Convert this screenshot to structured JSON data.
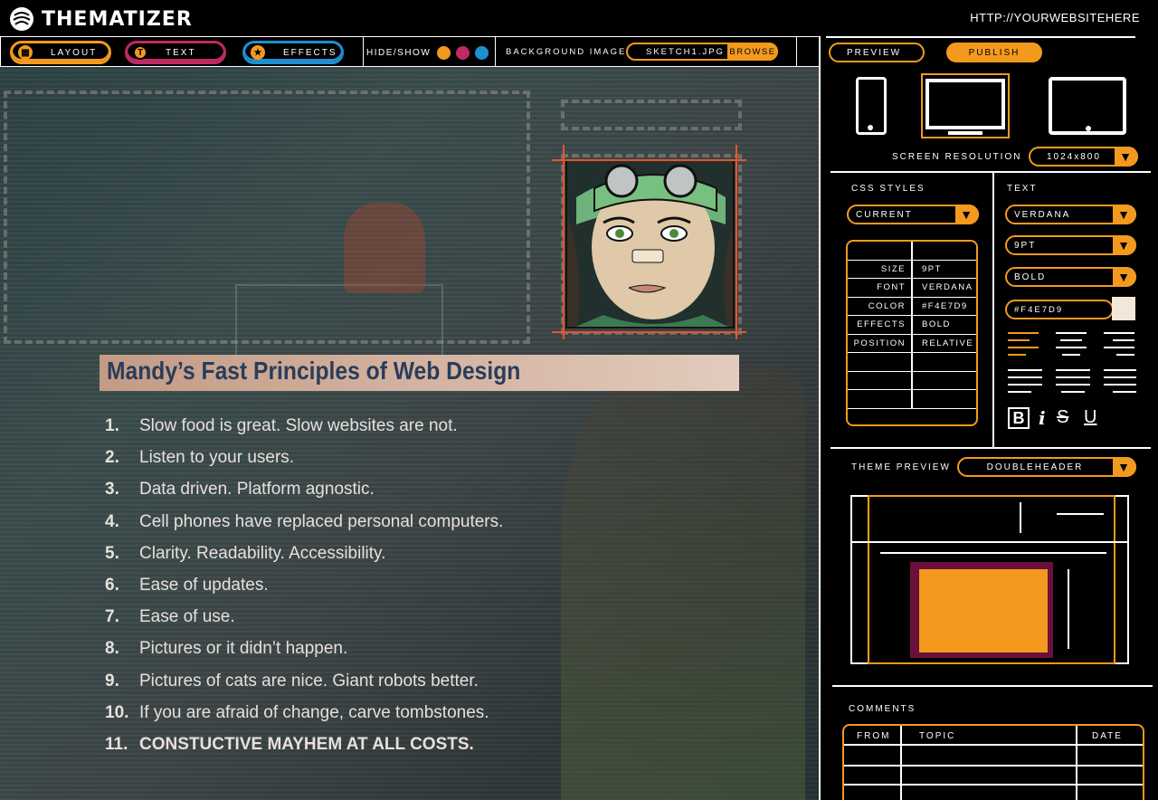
{
  "header": {
    "brand": "THEMATIZER",
    "url": "HTTP://YOURWEBSITEHERE"
  },
  "toolbar": {
    "tabs": [
      {
        "label": "LAYOUT",
        "color": "#f39a1e",
        "icon": "layout-icon"
      },
      {
        "label": "TEXT",
        "color": "#c02a62",
        "icon": "text-icon"
      },
      {
        "label": "EFFECTS",
        "color": "#1f8fcf",
        "icon": "star-icon"
      }
    ],
    "hide_show_label": "HIDE/SHOW",
    "background_image_label": "BACKGROUND IMAGE",
    "background_file": "SKETCH1.JPG",
    "browse_label": "BROWSE"
  },
  "canvas": {
    "heading": "Mandy’s Fast Principles of Web Design",
    "principles": [
      {
        "n": "1.",
        "text": "Slow food is great. Slow websites are not."
      },
      {
        "n": "2.",
        "text": "Listen to your users."
      },
      {
        "n": "3.",
        "text": "Data driven. Platform agnostic."
      },
      {
        "n": "4.",
        "text": "Cell phones have replaced personal computers."
      },
      {
        "n": "5.",
        "text": "Clarity. Readability. Accessibility."
      },
      {
        "n": "6.",
        "text": "Ease of updates."
      },
      {
        "n": "7.",
        "text": "Ease of use."
      },
      {
        "n": "8.",
        "text": "Pictures or it didn’t happen."
      },
      {
        "n": "9.",
        "text": "Pictures of cats are nice. Giant robots better."
      },
      {
        "n": "10.",
        "text": "If you are afraid of change, carve tombstones."
      },
      {
        "n": "11.",
        "text": "CONSTUCTIVE MAYHEM AT ALL COSTS."
      }
    ]
  },
  "panel": {
    "preview_label": "PREVIEW",
    "publish_label": "PUBLISH",
    "screen_resolution_label": "SCREEN RESOLUTION",
    "screen_resolution_value": "1024x800",
    "css_styles_label": "CSS STYLES",
    "css_styles_value": "CURRENT",
    "styles": [
      {
        "k": "SIZE",
        "v": "9PT"
      },
      {
        "k": "FONT",
        "v": "VERDANA"
      },
      {
        "k": "COLOR",
        "v": "#F4E7D9"
      },
      {
        "k": "EFFECTS",
        "v": "BOLD"
      },
      {
        "k": "POSITION",
        "v": "RELATIVE"
      }
    ],
    "text_label": "TEXT",
    "text_font": "VERDANA",
    "text_size": "9PT",
    "text_weight": "BOLD",
    "text_color": "#F4E7D9",
    "format_buttons": [
      "B",
      "i",
      "S",
      "U"
    ],
    "theme_preview_label": "THEME PREVIEW",
    "theme_value": "DOUBLEHEADER",
    "comments_label": "COMMENTS",
    "comments_columns": [
      "FROM",
      "TOPIC",
      "DATE"
    ]
  },
  "colors": {
    "accent": "#f39a1e",
    "text_pink": "#c02a62",
    "effects_blue": "#1f8fcf",
    "swatch": "#F4E7D9",
    "theme_purple": "#6b0f3c"
  }
}
